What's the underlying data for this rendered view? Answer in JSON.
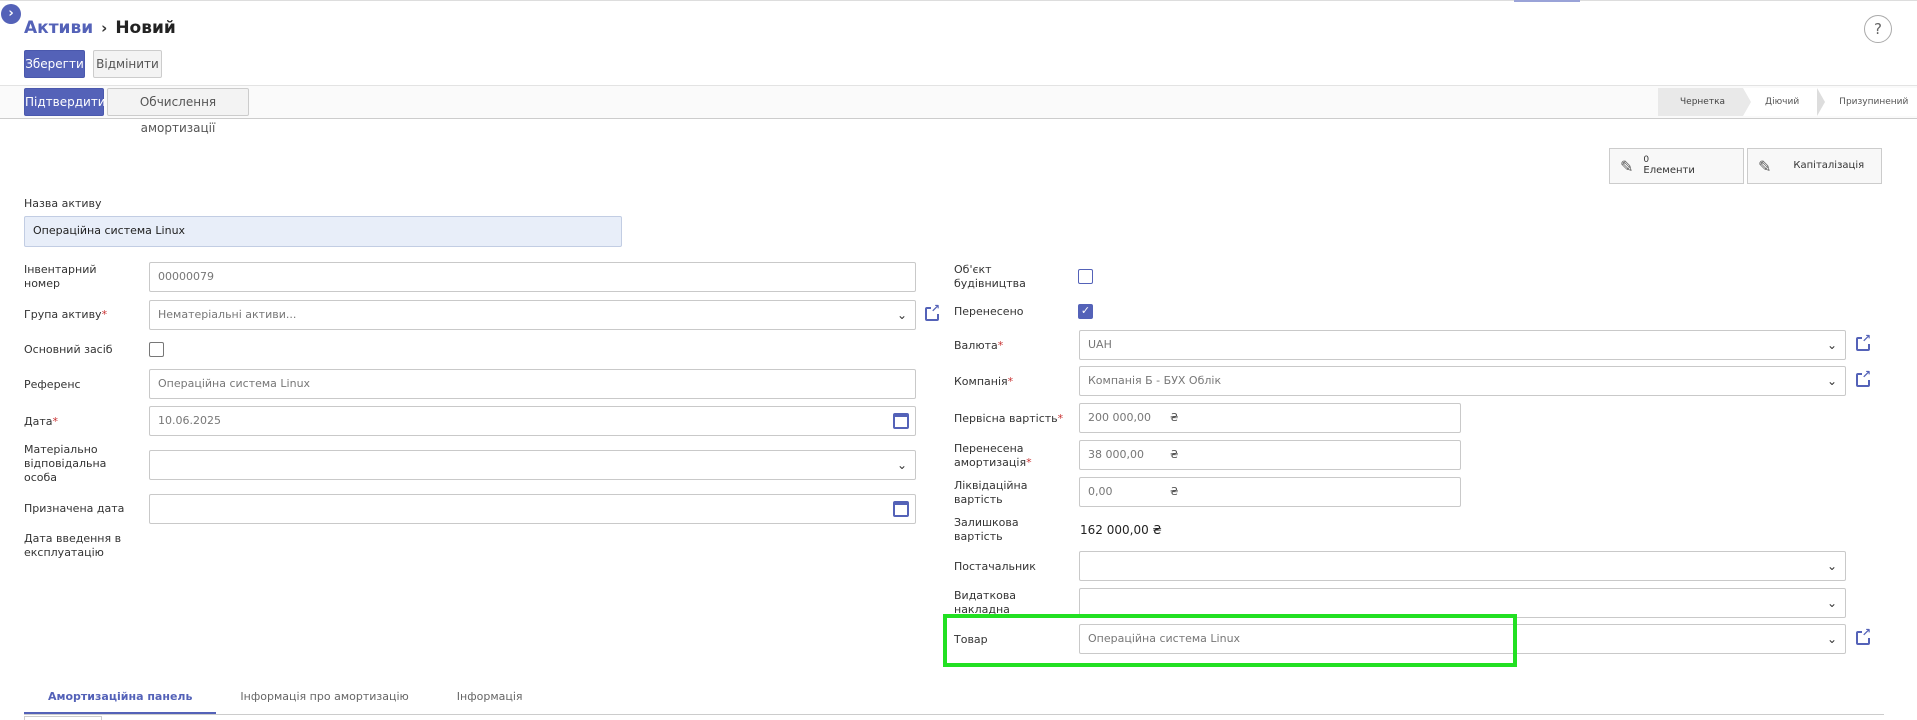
{
  "breadcrumb": {
    "parent": "Активи",
    "separator": "›",
    "current": "Новий"
  },
  "toolbar": {
    "save_label": "Зберегти",
    "discard_label": "Відмінити"
  },
  "status_buttons": {
    "confirm_label": "Підтвердити",
    "compute_label": "Обчислення амортизації"
  },
  "stages": [
    "Чернетка",
    "Діючий",
    "Призупинений"
  ],
  "active_stage": "Чернетка",
  "smart_buttons": {
    "elements": {
      "count": "0",
      "label": "Елементи"
    },
    "capitalization": {
      "label": "Капіталізація"
    }
  },
  "form": {
    "name_label": "Назва активу",
    "name_value": "Операційна система Linux",
    "left": {
      "inventory_label_1": "Інвентарний",
      "inventory_label_2": "номер",
      "inventory_value": "00000079",
      "group_label": "Група активу",
      "group_value": "Нематеріальні активи...",
      "main_asset_label": "Основний засіб",
      "reference_label": "Референс",
      "reference_value": "Операційна система Linux",
      "date_label": "Дата",
      "date_value": "10.06.2025",
      "responsible_label_1": "Матеріально",
      "responsible_label_2": "відповідальна",
      "responsible_label_3": "особа",
      "assigned_date_label": "Призначена дата",
      "commissioning_label_1": "Дата введення в",
      "commissioning_label_2": "експлуатацію"
    },
    "right": {
      "construction_label_1": "Об'єкт",
      "construction_label_2": "будівництва",
      "transferred_label": "Перенесено",
      "transferred_checked": true,
      "currency_label": "Валюта",
      "currency_value": "UAH",
      "company_label": "Компанія",
      "company_value": "Компанія Б - БУХ Облік",
      "original_value_label": "Первісна вартість",
      "original_value": "200 000,00",
      "transferred_depr_label_1": "Перенесена",
      "transferred_depr_label_2": "амортизація",
      "transferred_depr_value": "38 000,00",
      "salvage_label_1": "Ліквідаційна",
      "salvage_label_2": "вартість",
      "salvage_value": "0,00",
      "residual_label_1": "Залишкова",
      "residual_label_2": "вартість",
      "residual_value": "162 000,00 ₴",
      "currency_symbol": "₴",
      "supplier_label": "Постачальник",
      "invoice_label_1": "Видаткова",
      "invoice_label_2": "накладна",
      "product_label": "Товар",
      "product_value": "Операційна система Linux"
    }
  },
  "tabs": [
    "Амортизаційна панель",
    "Інформація про амортизацію",
    "Інформація"
  ],
  "colors": {
    "accent": "#5462b8",
    "highlight": "#22e022"
  }
}
